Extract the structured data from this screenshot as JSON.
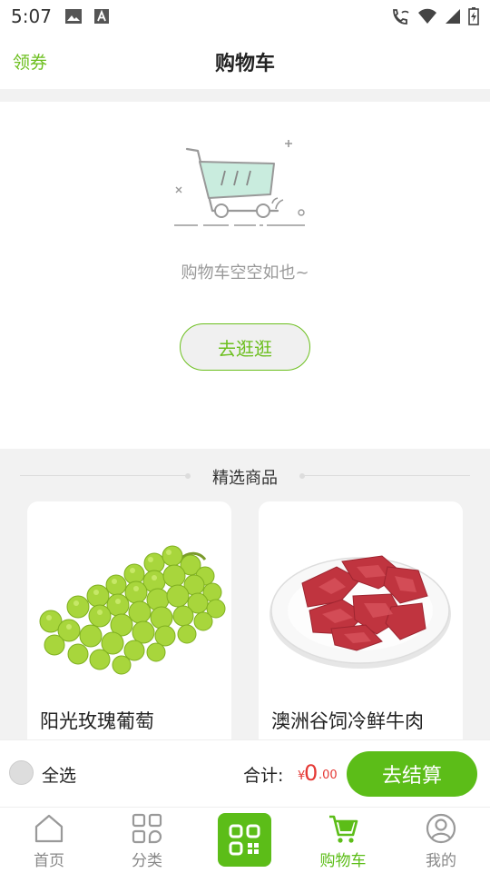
{
  "status_bar": {
    "time": "5:07",
    "left_icons": [
      "image-icon",
      "text-a-icon"
    ],
    "right_icons": [
      "phone-wifi-icon",
      "wifi-icon",
      "signal-icon",
      "battery-charging-icon"
    ]
  },
  "header": {
    "coupon_label": "领券",
    "title": "购物车"
  },
  "empty_cart": {
    "illustration": "empty-cart-icon",
    "message": "购物车空空如也~",
    "browse_label": "去逛逛"
  },
  "featured": {
    "title": "精选商品",
    "products": [
      {
        "name": "阳光玫瑰葡萄",
        "image": "green-grapes-image"
      },
      {
        "name": "澳洲谷饲冷鲜牛肉",
        "image": "sliced-beef-plate-image"
      }
    ]
  },
  "checkout": {
    "select_all_label": "全选",
    "select_all_checked": false,
    "total_label": "合计:",
    "currency_symbol": "¥",
    "total_integer": "0",
    "total_decimal": ".00",
    "checkout_label": "去结算"
  },
  "tab_bar": {
    "tabs": [
      {
        "label": "首页",
        "icon": "home-icon",
        "active": false
      },
      {
        "label": "分类",
        "icon": "category-grid-icon",
        "active": false
      },
      {
        "label": "",
        "icon": "qr-scan-icon",
        "active": false
      },
      {
        "label": "购物车",
        "icon": "cart-icon",
        "active": true
      },
      {
        "label": "我的",
        "icon": "profile-icon",
        "active": false
      }
    ]
  },
  "colors": {
    "accent": "#5cbd18",
    "price": "#e53935",
    "background_gray": "#f2f2f2"
  }
}
